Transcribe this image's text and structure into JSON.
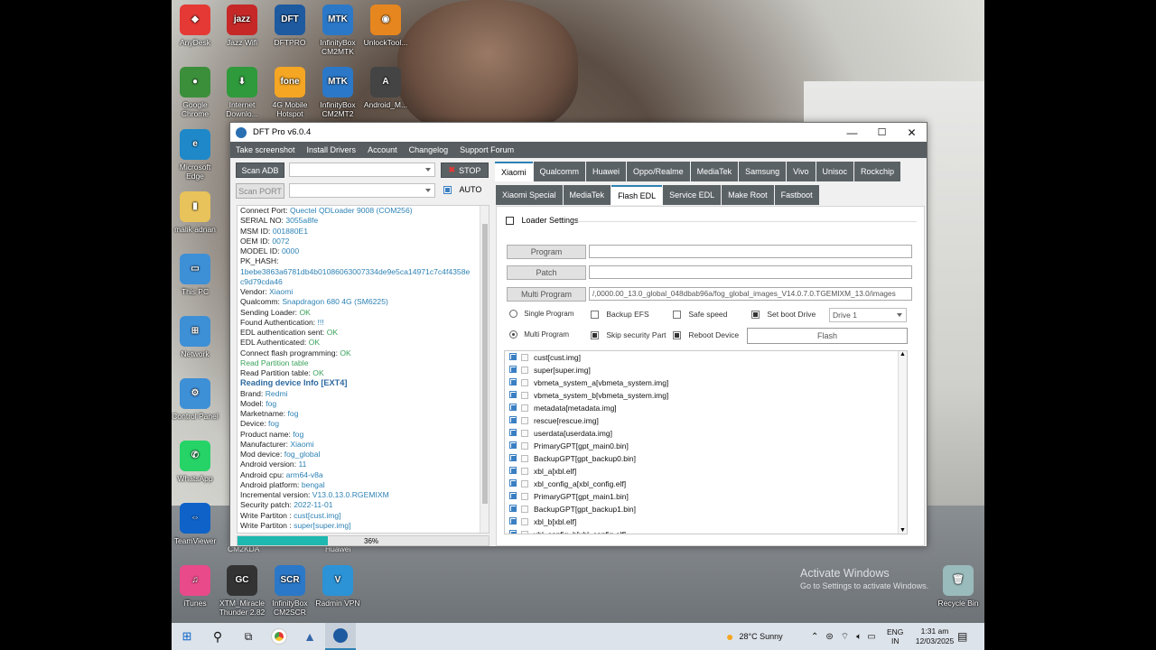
{
  "window": {
    "title": "DFT Pro v6.0.4",
    "minimize": "—",
    "maximize": "☐",
    "close": "✕"
  },
  "menu": [
    "Take screenshot",
    "Install Drivers",
    "Account",
    "Changelog",
    "Support Forum"
  ],
  "controls": {
    "scan_adb": "Scan ADB",
    "stop": "STOP",
    "scan_port": "Scan PORT",
    "auto": "AUTO",
    "auto_checked": true
  },
  "log": [
    {
      "k": "Connect Port: ",
      "v": "Quectel QDLoader 9008 (COM256)"
    },
    {
      "k": "SERIAL NO: ",
      "v": "3055a8fe"
    },
    {
      "k": "MSM ID: ",
      "v": "001880E1"
    },
    {
      "k": "OEM ID: ",
      "v": "0072"
    },
    {
      "k": "MODEL ID: ",
      "v": "0000"
    },
    {
      "k": "PK_HASH:",
      "v": ""
    },
    {
      "k": "",
      "v": "1bebe3863a6781db4b01086063007334de9e5ca14971c7c4f4358e"
    },
    {
      "k": "",
      "v": "c9d79cda46"
    },
    {
      "k": "Vendor: ",
      "v": "Xiaomi"
    },
    {
      "k": "Qualcomm: ",
      "v": "Snapdragon 680 4G (SM6225)"
    },
    {
      "k": "Sending Loader: ",
      "g": "OK"
    },
    {
      "k": "Found Authentication: ",
      "v": "!!!"
    },
    {
      "k": "EDL authentication sent: ",
      "g": "OK"
    },
    {
      "k": "EDL Authenticated: ",
      "g": "OK"
    },
    {
      "k": "Connect flash programming: ",
      "g": "OK"
    },
    {
      "green": "Read Partition table"
    },
    {
      "k": "Read Partition table: ",
      "g": "OK"
    },
    {
      "hdr": "Reading device Info [EXT4]"
    },
    {
      "k": "Brand: ",
      "v": "Redmi"
    },
    {
      "k": "Model: ",
      "v": "fog"
    },
    {
      "k": "Marketname: ",
      "v": "fog"
    },
    {
      "k": "Device: ",
      "v": "fog"
    },
    {
      "k": "Product name: ",
      "v": "fog"
    },
    {
      "k": "Manufacturer: ",
      "v": "Xiaomi"
    },
    {
      "k": "Mod device: ",
      "v": "fog_global"
    },
    {
      "k": "Android version: ",
      "v": "11"
    },
    {
      "k": "Android cpu: ",
      "v": "arm64-v8a"
    },
    {
      "k": "Android platform: ",
      "v": "bengal"
    },
    {
      "k": "Incremental version: ",
      "v": "V13.0.13.0.RGEMIXM"
    },
    {
      "k": "Security patch: ",
      "v": "2022-11-01"
    },
    {
      "k": "Write Partiton : ",
      "v": "cust[cust.img]"
    },
    {
      "k": "Write Partiton : ",
      "v": "super[super.img]"
    }
  ],
  "progress": {
    "percent": 36,
    "label": "36%"
  },
  "brand_tabs": [
    "Xiaomi",
    "Qualcomm",
    "Huawei",
    "Oppo/Realme",
    "MediaTek",
    "Samsung",
    "Vivo",
    "Unisoc",
    "Rockchip"
  ],
  "brand_active": 0,
  "sub_tabs": [
    "Xiaomi Special",
    "MediaTek",
    "Flash EDL",
    "Service EDL",
    "Make Root",
    "Fastboot"
  ],
  "sub_active": 2,
  "flash": {
    "loader_settings": "Loader Settings",
    "program_btn": "Program",
    "program_val": "",
    "patch_btn": "Patch",
    "patch_val": "",
    "multi_btn": "Multi Program",
    "multi_val": "/,0000.00_13.0_global_048dbab96a/fog_global_images_V14.0.7.0.TGEMIXM_13.0/images",
    "single_program": "Single Program",
    "multi_program": "Multi Program",
    "backup_efs": "Backup EFS",
    "safe_speed": "Safe speed",
    "set_boot_drive": "Set boot Drive",
    "drive": "Drive 1",
    "skip_security": "Skip security Part",
    "reboot_device": "Reboot Device",
    "flash_btn": "Flash"
  },
  "partitions": [
    "cust[cust.img]",
    "super[super.img]",
    "vbmeta_system_a[vbmeta_system.img]",
    "vbmeta_system_b[vbmeta_system.img]",
    "metadata[metadata.img]",
    "rescue[rescue.img]",
    "userdata[userdata.img]",
    "PrimaryGPT[gpt_main0.bin]",
    "BackupGPT[gpt_backup0.bin]",
    "xbl_a[xbl.elf]",
    "xbl_config_a[xbl_config.elf]",
    "PrimaryGPT[gpt_main1.bin]",
    "BackupGPT[gpt_backup1.bin]",
    "xbl_b[xbl.elf]",
    "xbl_config_b[xbl_config.elf]"
  ],
  "desktop_icons": [
    {
      "label": "AnyDesk",
      "color": "#e53935",
      "glyph": "◆"
    },
    {
      "label": "Jazz Wifi",
      "color": "#c62828",
      "glyph": "jazz"
    },
    {
      "label": "DFTPRO",
      "color": "#1e5aa0",
      "glyph": "DFT"
    },
    {
      "label": "InfinityBox CM2MTK",
      "color": "#2b78c8",
      "glyph": "MTK"
    },
    {
      "label": "UnlockTool...",
      "color": "#e6861f",
      "glyph": "◉"
    },
    {
      "label": "Google Chrome",
      "color": "#3b8f3b",
      "glyph": "●"
    },
    {
      "label": "Internet Downlo...",
      "color": "#2e9a3b",
      "glyph": "⬇"
    },
    {
      "label": "4G Mobile Hotspot",
      "color": "#f5a623",
      "glyph": "fone"
    },
    {
      "label": "InfinityBox CM2MT2",
      "color": "#2b78c8",
      "glyph": "MTK"
    },
    {
      "label": "Android_M...",
      "color": "#444",
      "glyph": "A"
    },
    {
      "label": "Microsoft Edge",
      "color": "#1e88c8",
      "glyph": "e"
    },
    {
      "label": "malik adnan",
      "color": "#e8c25a",
      "glyph": "▮"
    },
    {
      "label": "This PC",
      "color": "#3d8fd6",
      "glyph": "▭"
    },
    {
      "label": "Network",
      "color": "#3d8fd6",
      "glyph": "⊞"
    },
    {
      "label": "Control Panel",
      "color": "#3d8fd6",
      "glyph": "⚙"
    },
    {
      "label": "WhatsApp",
      "color": "#25d366",
      "glyph": "✆"
    },
    {
      "label": "TeamViewer",
      "color": "#0e62c8",
      "glyph": "⇔"
    },
    {
      "label": "iTunes",
      "color": "#e84a8a",
      "glyph": "♫"
    },
    {
      "label": "XTM_Miracle Thunder 2.82",
      "color": "#333",
      "glyph": "GC"
    },
    {
      "label": "InfinityBox CM2SCR",
      "color": "#2b78c8",
      "glyph": "SCR"
    },
    {
      "label": "Radmin VPN",
      "color": "#2b93d6",
      "glyph": "V"
    },
    {
      "label": "Recycle Bin",
      "color": "#9bb",
      "glyph": "🗑"
    }
  ],
  "behind_labels": [
    "CM2KDA",
    "Huawei"
  ],
  "watermark": {
    "line1": "Activate Windows",
    "line2": "Go to Settings to activate Windows."
  },
  "taskbar": {
    "weather": "28°C  Sunny",
    "lang1": "ENG",
    "lang2": "IN",
    "time": "1:31 am",
    "date": "12/03/2025"
  }
}
